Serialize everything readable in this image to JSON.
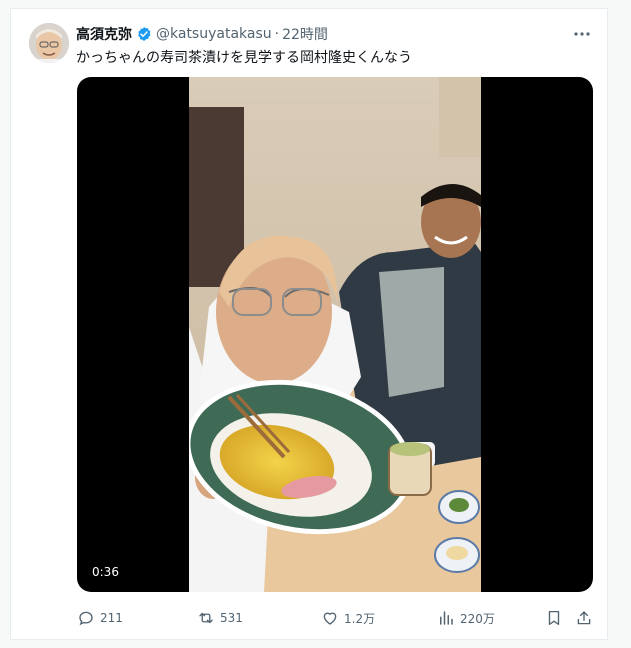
{
  "tweet": {
    "author_name": "高須克弥",
    "handle": "@katsuyatakasu",
    "separator": "·",
    "time": "22時間",
    "text": "かっちゃんの寿司茶漬けを見学する岡村隆史くんなう",
    "verified_color": "#1d9bf0"
  },
  "media": {
    "duration": "0:36"
  },
  "actions": {
    "replies": "211",
    "retweets": "531",
    "likes": "1.2万",
    "views": "220万"
  }
}
